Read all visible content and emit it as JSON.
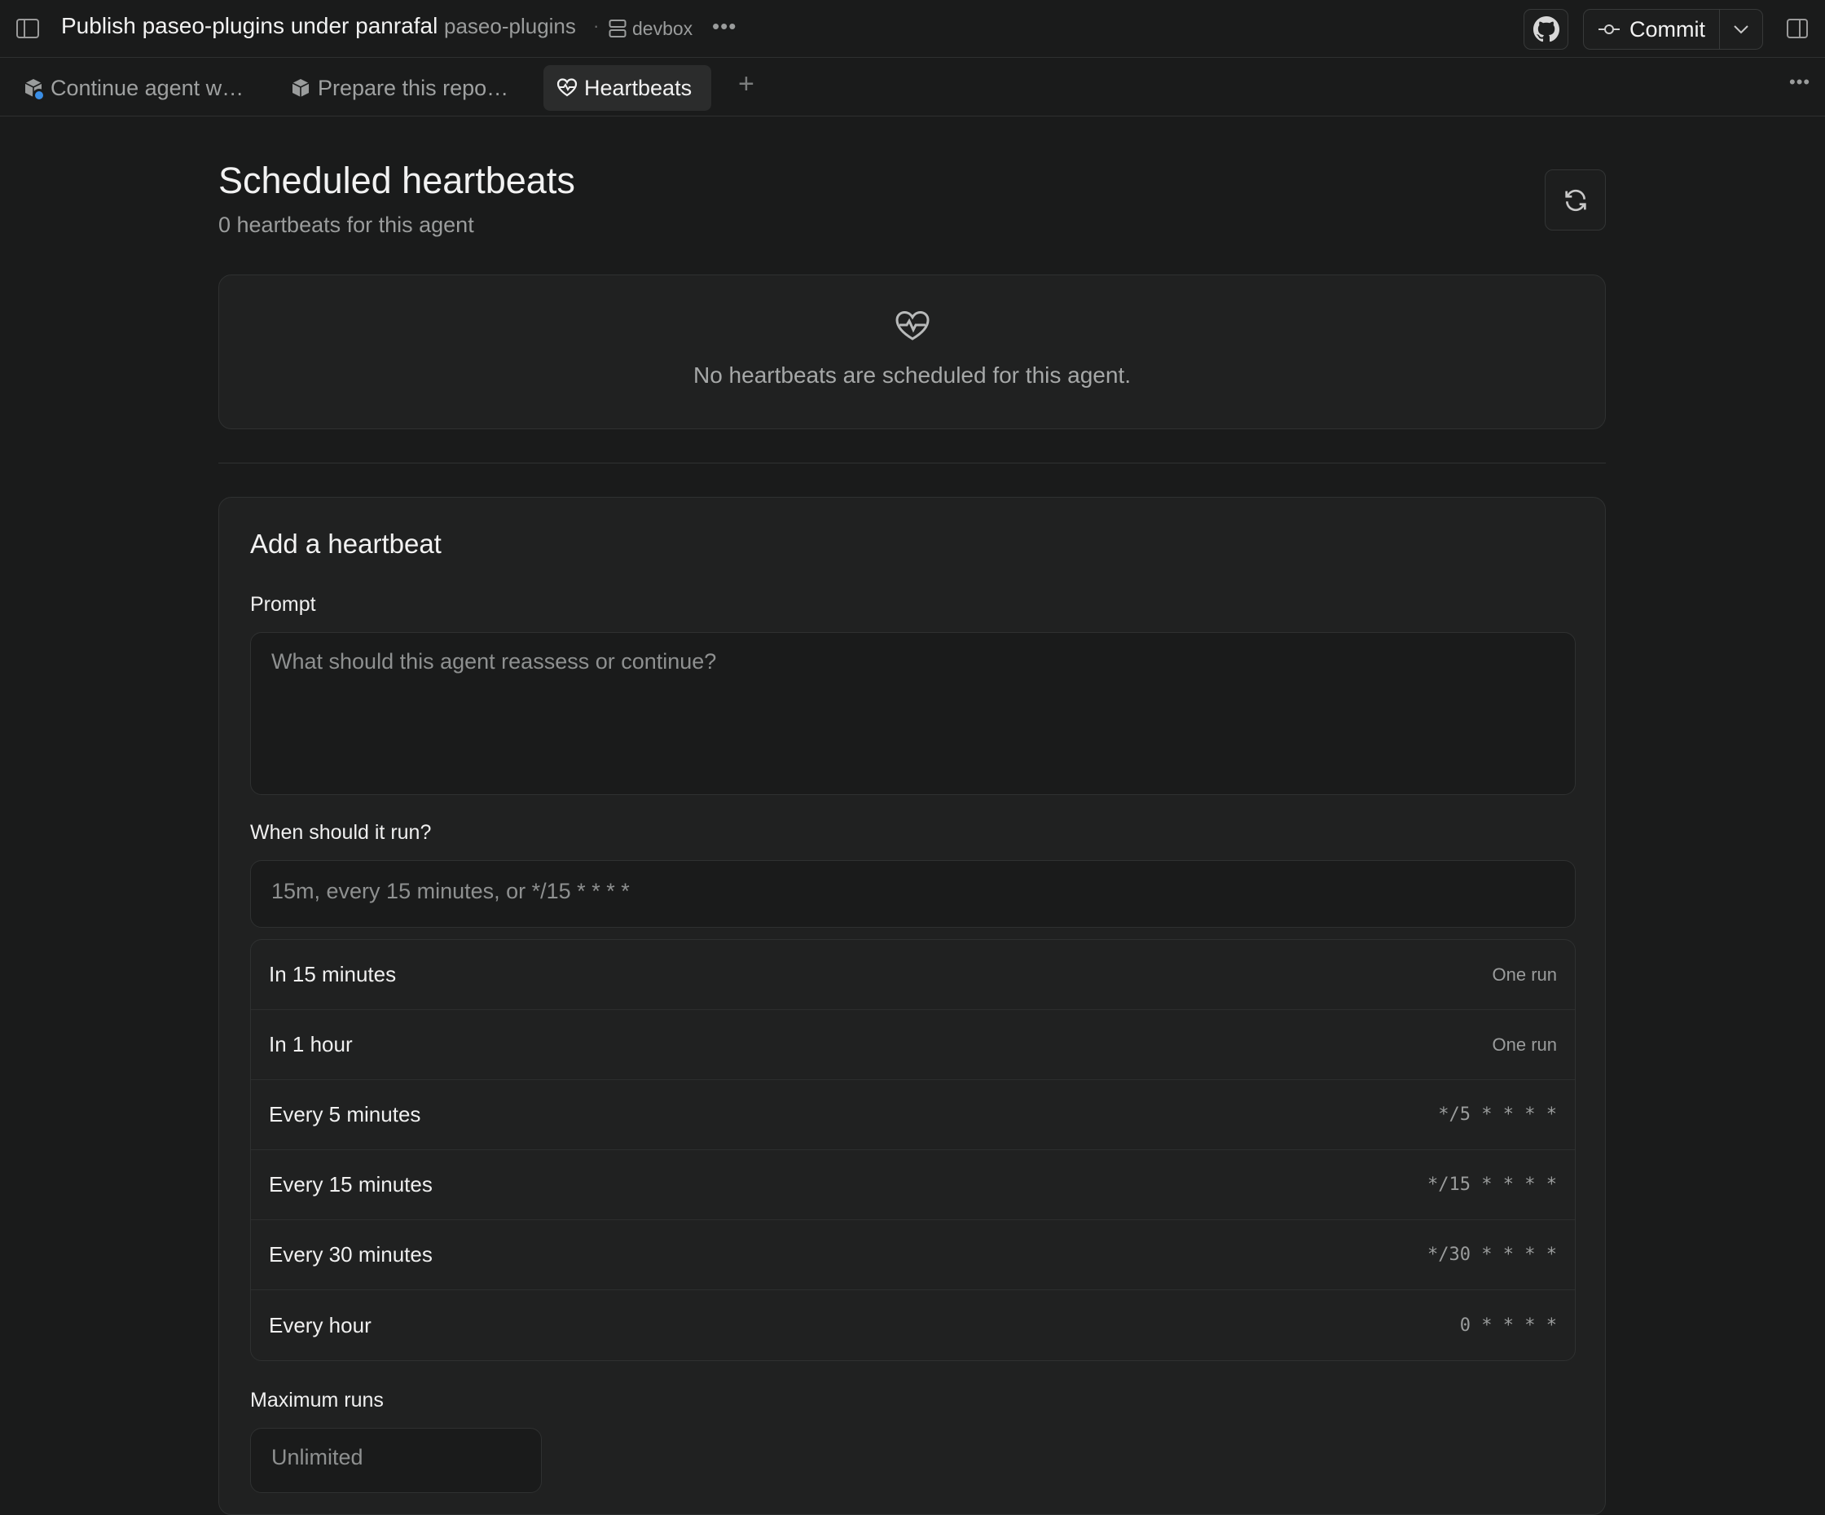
{
  "header": {
    "title": "Publish paseo-plugins under panrafal",
    "repo": "paseo-plugins",
    "separator": "·",
    "host": "devbox",
    "more": "•••",
    "commit_label": "Commit"
  },
  "tabs": [
    {
      "label": "Continue agent w…"
    },
    {
      "label": "Prepare this repo…"
    },
    {
      "label": "Heartbeats"
    }
  ],
  "tabbar": {
    "add": "+",
    "more": "•••"
  },
  "main": {
    "title": "Scheduled heartbeats",
    "subtitle": "0 heartbeats for this agent",
    "empty_text": "No heartbeats are scheduled for this agent."
  },
  "form": {
    "title": "Add a heartbeat",
    "prompt_label": "Prompt",
    "prompt_placeholder": "What should this agent reassess or continue?",
    "when_label": "When should it run?",
    "when_placeholder": "15m, every 15 minutes, or */15 * * * *",
    "presets": [
      {
        "label": "In 15 minutes",
        "hint": "One run"
      },
      {
        "label": "In 1 hour",
        "hint": "One run"
      },
      {
        "label": "Every 5 minutes",
        "hint": "*/5 * * * *"
      },
      {
        "label": "Every 15 minutes",
        "hint": "*/15 * * * *"
      },
      {
        "label": "Every 30 minutes",
        "hint": "*/30 * * * *"
      },
      {
        "label": "Every hour",
        "hint": "0 * * * *"
      }
    ],
    "max_runs_label": "Maximum runs",
    "max_runs_placeholder": "Unlimited"
  },
  "colors": {
    "accent": "#3a8ee6",
    "background": "#1a1b1b",
    "card": "#202121"
  }
}
